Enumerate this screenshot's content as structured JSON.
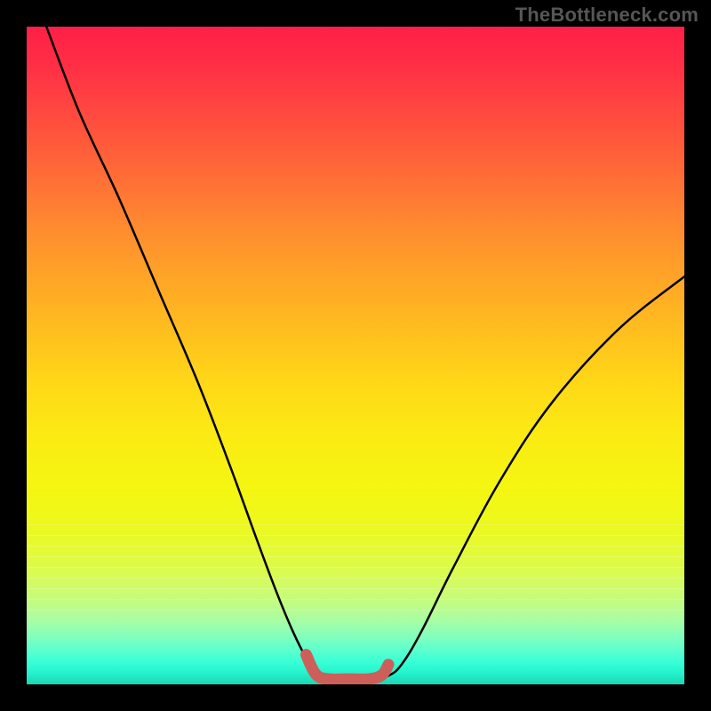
{
  "watermark": "TheBottleneck.com",
  "chart_data": {
    "type": "line",
    "title": "",
    "xlabel": "",
    "ylabel": "",
    "xlim": [
      0,
      100
    ],
    "ylim": [
      0,
      100
    ],
    "grid": false,
    "series": [
      {
        "name": "black-curve",
        "x": [
          3,
          8,
          14,
          20,
          26,
          31,
          35,
          38,
          40.5,
          42.5,
          44,
          45,
          46,
          47.5,
          50,
          52.5,
          55,
          57,
          60,
          65,
          72,
          80,
          90,
          100
        ],
        "y": [
          100,
          87,
          74,
          60,
          46,
          33,
          22,
          14,
          8,
          4,
          1.8,
          0.8,
          0.5,
          0.5,
          0.5,
          0.6,
          1.3,
          3,
          8,
          18,
          31,
          43,
          54,
          62
        ]
      },
      {
        "name": "red-emphasis-floor",
        "x": [
          42.5,
          44,
          46,
          49,
          52,
          54,
          55
        ],
        "y": [
          4.5,
          1.5,
          0.8,
          0.8,
          0.8,
          1.4,
          3.0
        ]
      }
    ],
    "gradient_stops": [
      {
        "pos": 0.0,
        "color": "#ff1f47"
      },
      {
        "pos": 0.3,
        "color": "#ff8930"
      },
      {
        "pos": 0.62,
        "color": "#fbea13"
      },
      {
        "pos": 0.88,
        "color": "#c3fc82"
      },
      {
        "pos": 1.0,
        "color": "#1bd7b5"
      }
    ]
  }
}
